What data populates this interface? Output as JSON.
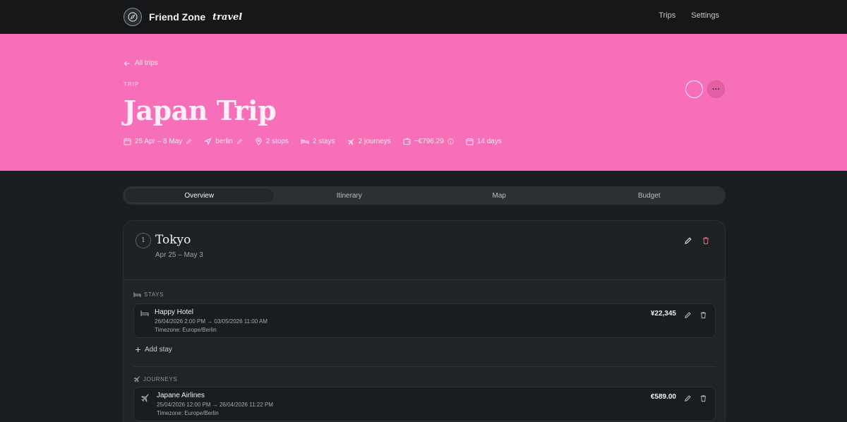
{
  "nav": {
    "brand_name": "Friend Zone",
    "brand_sub": "travel",
    "links": [
      "Trips",
      "Settings"
    ]
  },
  "hero": {
    "back_label": "All trips",
    "label": "TRIP",
    "title": "Japan Trip",
    "more_label": "···",
    "meta": {
      "dates": "25 Apr – 8 May",
      "origin": "berlin",
      "stops": "2 stops",
      "stays": "2 stays",
      "journeys": "2 journeys",
      "budget": "~€796.29",
      "duration": "14 days"
    },
    "color": "#f76fb8"
  },
  "tabs": [
    "Overview",
    "Itinerary",
    "Map",
    "Budget"
  ],
  "active_tab": "Overview",
  "stop": {
    "number": "1",
    "name": "Tokyo",
    "dates": "Apr 25 – May 3",
    "stays_label": "STAYS",
    "add_stay_label": "Add stay",
    "journeys_label": "JOURNEYS",
    "stays": [
      {
        "name": "Happy Hotel",
        "dates": "26/04/2026 2:00 PM → 03/05/2026 11:00 AM",
        "timezone": "Timezone: Europe/Berlin",
        "price": "¥22,345"
      }
    ],
    "journeys": [
      {
        "name": "Japane Airlines",
        "dates": "25/04/2026 12:00 PM → 26/04/2026 11:22 PM",
        "timezone": "Timezone: Europe/Berlin",
        "price": "€589.00"
      }
    ]
  }
}
